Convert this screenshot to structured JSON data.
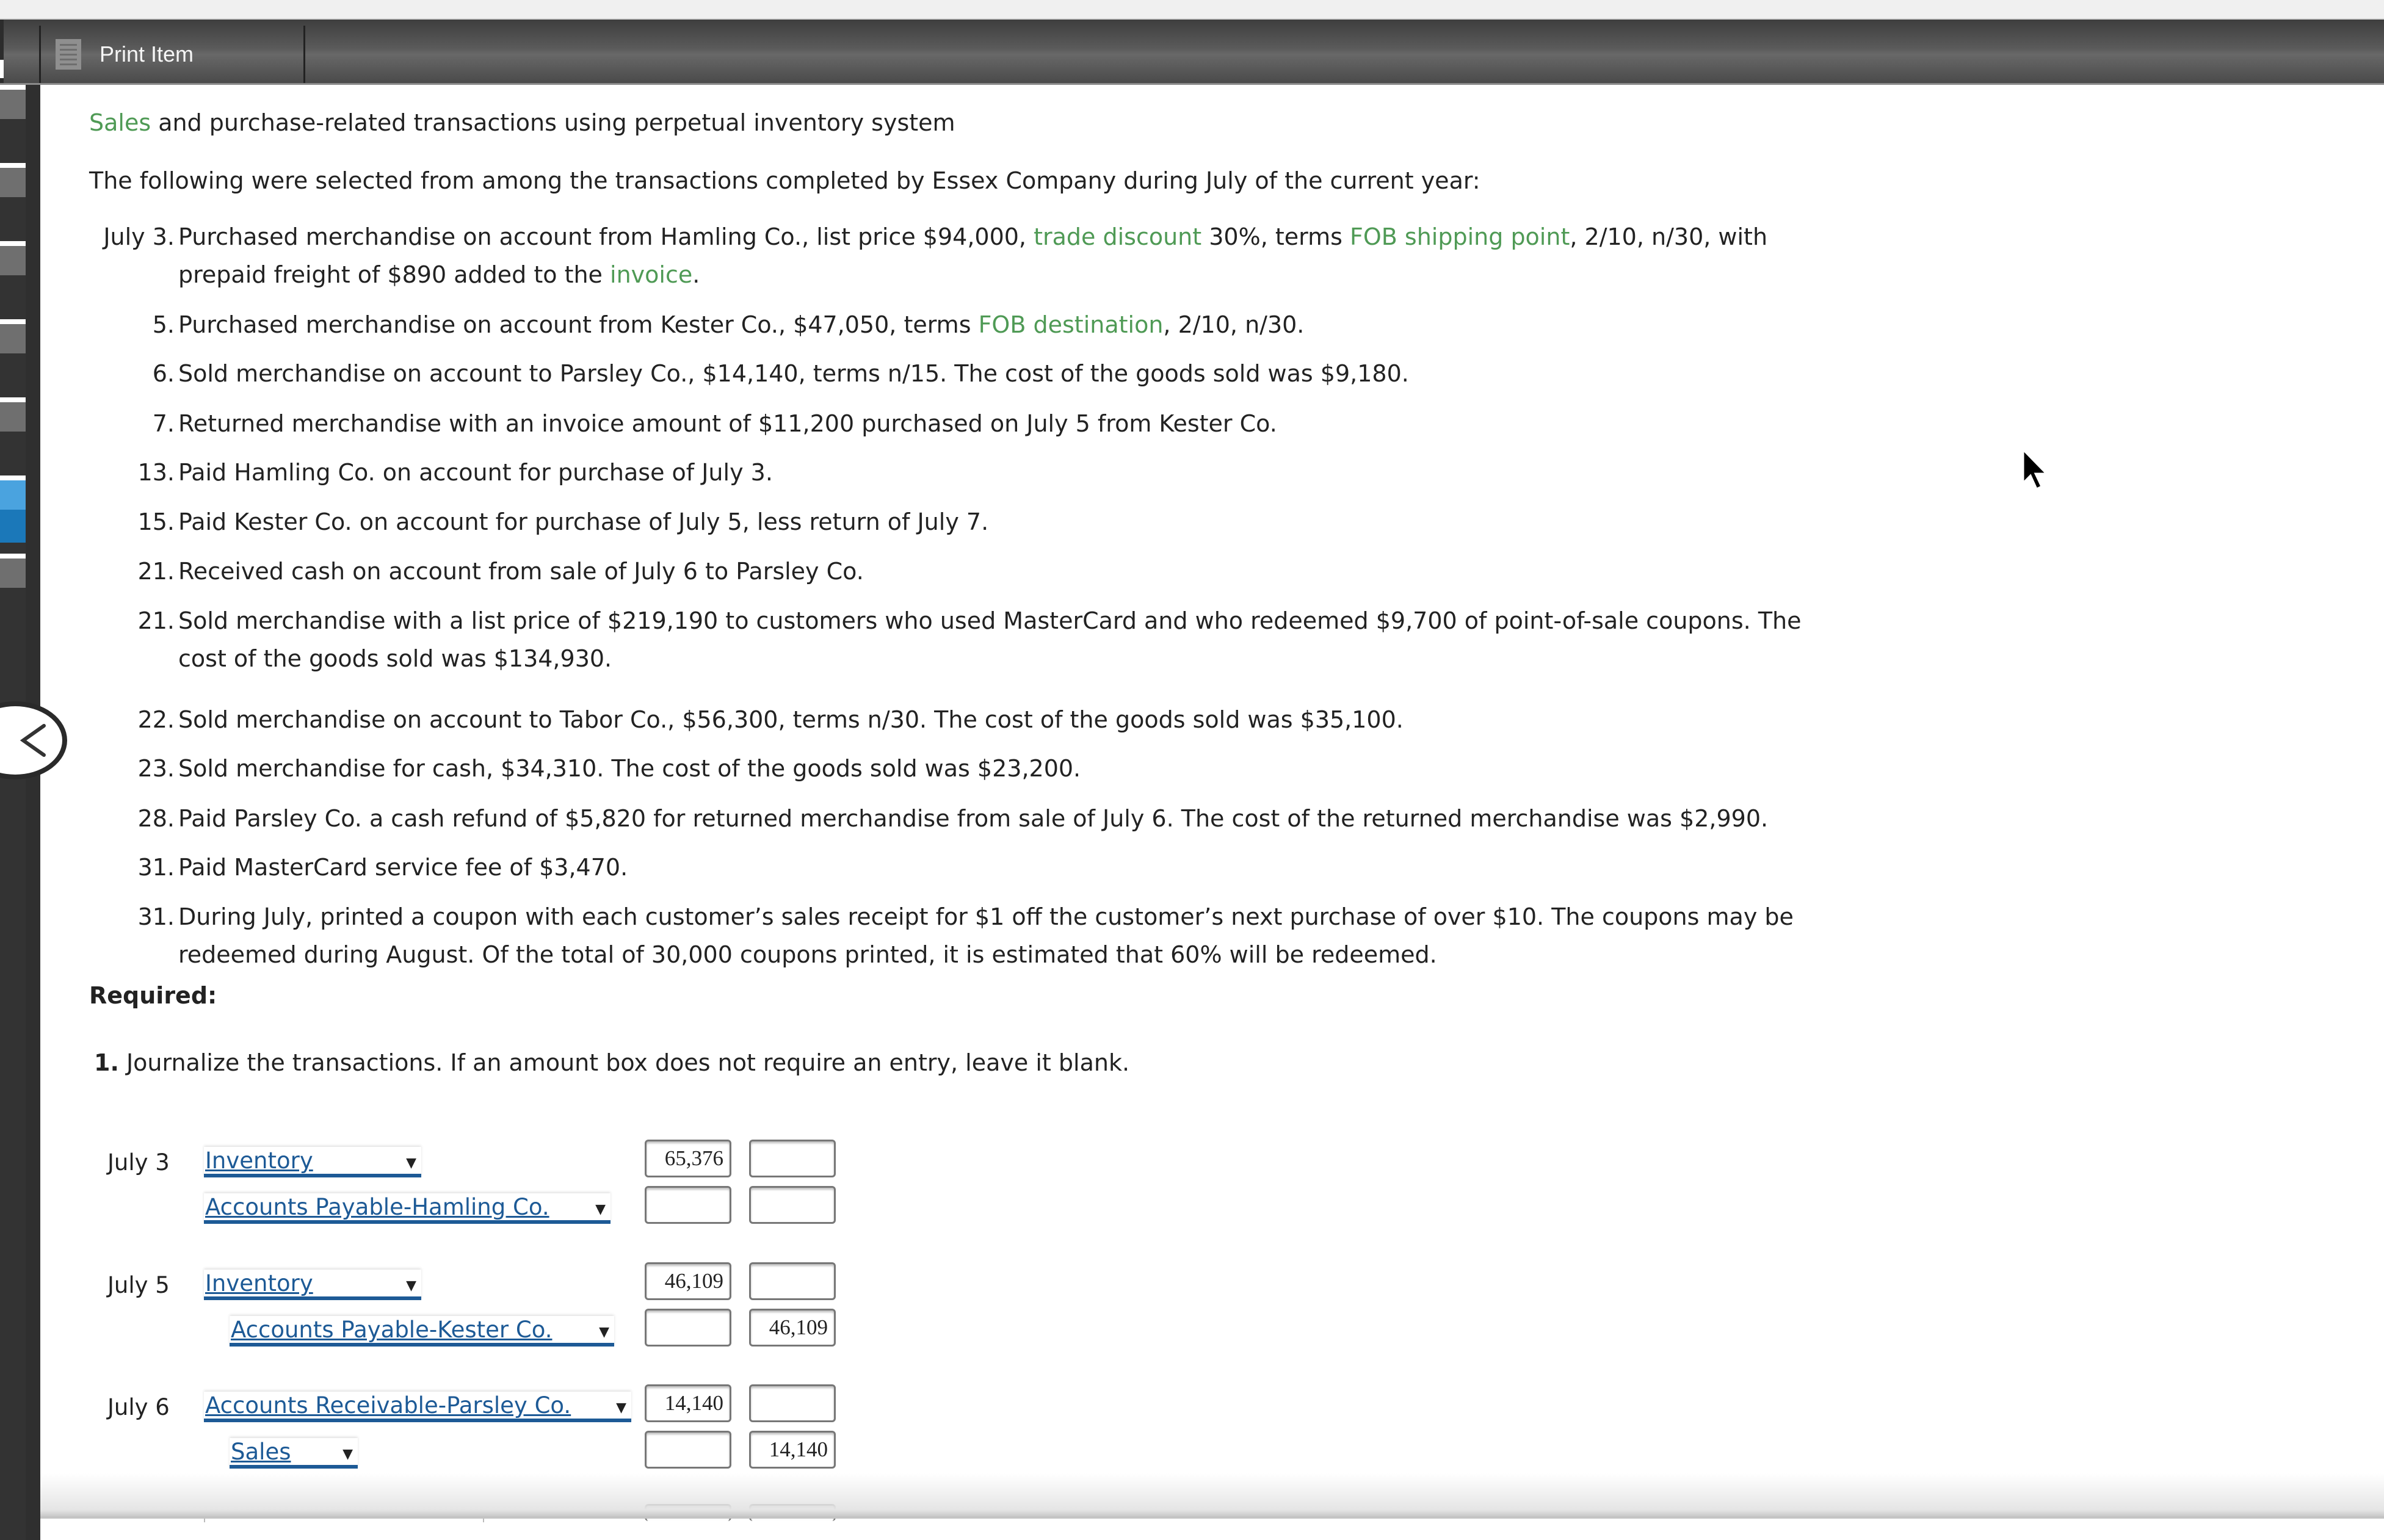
{
  "header": {
    "tab_label": "Print Item",
    "tab_icon": "document-icon"
  },
  "sidebar": {
    "tab_count": 7,
    "active_tab_index": 5,
    "back_button_icon": "chevron-left-icon",
    "colors": {
      "active": "#4aa3df",
      "active_dark": "#1b78b9",
      "inactive": "#6f6f6f"
    }
  },
  "title": {
    "link": "Sales",
    "rest": " and purchase-related transactions using perpetual inventory system"
  },
  "intro": "The following were selected from among the transactions completed by Essex Company during July of the current year:",
  "transactions": [
    {
      "num": "July 3.",
      "line1": [
        {
          "t": "Purchased merchandise on account from Hamling Co., list price $94,000, "
        },
        {
          "t": "trade discount",
          "link": true
        },
        {
          "t": " 30%, terms "
        },
        {
          "t": "FOB shipping point",
          "link": true
        },
        {
          "t": ", 2/10, n/30, with"
        }
      ],
      "line2": [
        {
          "t": "prepaid freight of $890 added to the "
        },
        {
          "t": "invoice",
          "link": true
        },
        {
          "t": "."
        }
      ]
    },
    {
      "num": "5.",
      "line1": [
        {
          "t": "Purchased merchandise on account from Kester Co., $47,050, terms "
        },
        {
          "t": "FOB destination",
          "link": true
        },
        {
          "t": ", 2/10, n/30."
        }
      ]
    },
    {
      "num": "6.",
      "line1": [
        {
          "t": "Sold merchandise on account to Parsley Co., $14,140, terms n/15. The cost of the goods sold was $9,180."
        }
      ]
    },
    {
      "num": "7.",
      "line1": [
        {
          "t": "Returned merchandise with an invoice amount of $11,200 purchased on July 5 from Kester Co."
        }
      ]
    },
    {
      "num": "13.",
      "line1": [
        {
          "t": "Paid Hamling Co. on account for purchase of July 3."
        }
      ]
    },
    {
      "num": "15.",
      "line1": [
        {
          "t": "Paid Kester Co. on account for purchase of July 5, less return of July 7."
        }
      ]
    },
    {
      "num": "21.",
      "line1": [
        {
          "t": "Received cash on account from sale of July 6 to Parsley Co."
        }
      ]
    },
    {
      "num": "21.",
      "line1": [
        {
          "t": "Sold merchandise with a list price of $219,190 to customers who used MasterCard and who redeemed $9,700 of point-of-sale coupons. The"
        }
      ],
      "line2": [
        {
          "t": "cost of the goods sold was $134,930."
        }
      ]
    },
    {
      "num": "22.",
      "line1": [
        {
          "t": "Sold merchandise on account to Tabor Co., $56,300, terms n/30. The cost of the goods sold was $35,100."
        }
      ]
    },
    {
      "num": "23.",
      "line1": [
        {
          "t": "Sold merchandise for cash, $34,310. The cost of the goods sold was $23,200."
        }
      ]
    },
    {
      "num": "28.",
      "line1": [
        {
          "t": "Paid Parsley Co. a cash refund of $5,820 for returned merchandise from sale of July 6. The cost of the returned merchandise was $2,990."
        }
      ]
    },
    {
      "num": "31.",
      "line1": [
        {
          "t": "Paid MasterCard service fee of $3,470."
        }
      ]
    },
    {
      "num": "31.",
      "line1": [
        {
          "t": "During July, printed a coupon with each customer’s sales receipt for $1 off the customer’s next purchase of over $10. The coupons may be"
        }
      ],
      "line2": [
        {
          "t": "redeemed during August. Of the total of 30,000 coupons printed, it is estimated that 60% will be redeemed."
        }
      ]
    }
  ],
  "required": {
    "heading": "Required:",
    "item_num": "1.",
    "item_text": " Journalize the transactions. If an amount box does not require an entry, leave it blank."
  },
  "journal": [
    {
      "date": "July 3",
      "rows": [
        {
          "account": "Inventory",
          "debit": "65,376",
          "credit": ""
        },
        {
          "account": "Accounts Payable-Hamling Co.",
          "debit": "",
          "credit": ""
        }
      ]
    },
    {
      "date": "July 5",
      "rows": [
        {
          "account": "Inventory",
          "debit": "46,109",
          "credit": ""
        },
        {
          "account": "Accounts Payable-Kester Co.",
          "debit": "",
          "credit": "46,109"
        }
      ]
    },
    {
      "date": "July 6",
      "rows": [
        {
          "account": "Accounts Receivable-Parsley Co.",
          "debit": "14,140",
          "credit": ""
        },
        {
          "account": "Sales",
          "debit": "",
          "credit": "14,140"
        }
      ]
    }
  ],
  "colors": {
    "link_green": "#4f9a55",
    "select_blue": "#1d5a96",
    "header_dark": "#4a4a4a"
  }
}
